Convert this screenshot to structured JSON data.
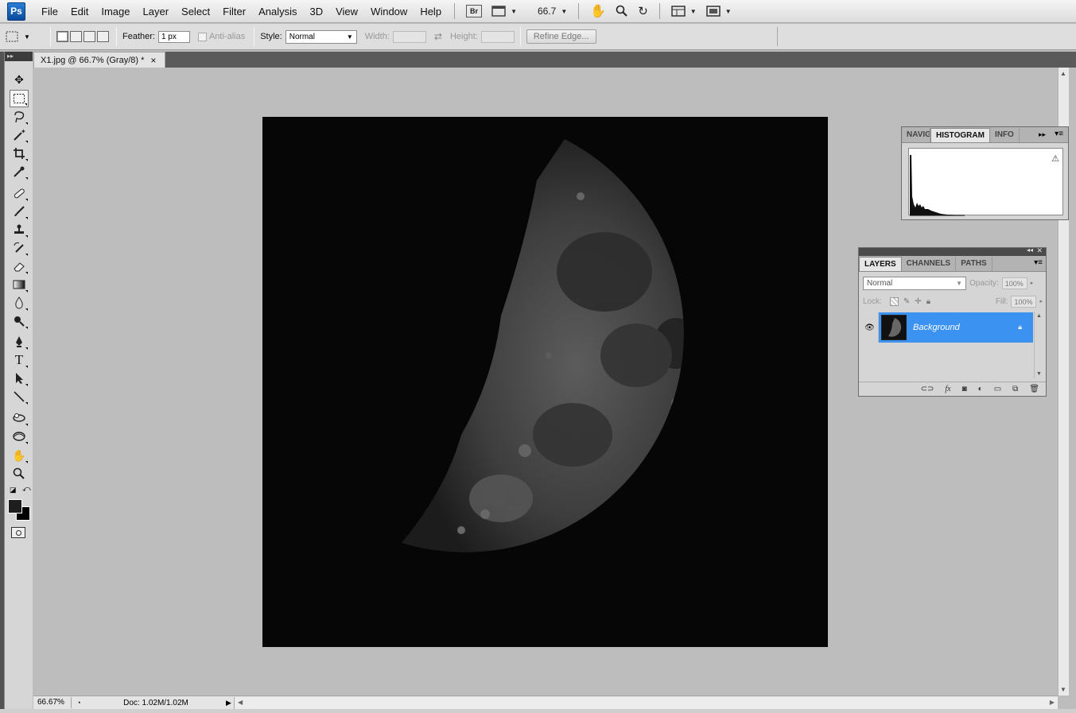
{
  "app": {
    "logo": "Ps"
  },
  "menu": [
    "File",
    "Edit",
    "Image",
    "Layer",
    "Select",
    "Filter",
    "Analysis",
    "3D",
    "View",
    "Window",
    "Help"
  ],
  "menubar_tools": {
    "bridge": "Br",
    "zoom_value": "66.7"
  },
  "options": {
    "feather_label": "Feather:",
    "feather_value": "1 px",
    "antialias_label": "Anti-alias",
    "style_label": "Style:",
    "style_value": "Normal",
    "width_label": "Width:",
    "height_label": "Height:",
    "refine_edge": "Refine Edge..."
  },
  "document": {
    "tab_title": "X1.jpg @ 66.7% (Gray/8) *",
    "close": "×"
  },
  "status": {
    "zoom": "66.67%",
    "doc_size": "Doc: 1.02M/1.02M"
  },
  "histogram_panel": {
    "tabs": [
      "NAVIG",
      "HISTOGRAM",
      "INFO"
    ],
    "active_tab": "HISTOGRAM"
  },
  "layers_panel": {
    "tabs": [
      "LAYERS",
      "CHANNELS",
      "PATHS"
    ],
    "active_tab": "LAYERS",
    "blend_mode": "Normal",
    "opacity_label": "Opacity:",
    "opacity_value": "100%",
    "lock_label": "Lock:",
    "fill_label": "Fill:",
    "fill_value": "100%",
    "layers": [
      {
        "name": "Background",
        "visible": true,
        "locked": true
      }
    ]
  },
  "icons": {
    "tools": [
      "move-tool-icon",
      "marquee-tool-icon",
      "lasso-tool-icon",
      "magic-wand-tool-icon",
      "crop-tool-icon",
      "eyedropper-tool-icon",
      "healing-brush-tool-icon",
      "brush-tool-icon",
      "clone-stamp-tool-icon",
      "history-brush-tool-icon",
      "eraser-tool-icon",
      "gradient-tool-icon",
      "blur-tool-icon",
      "dodge-tool-icon",
      "pen-tool-icon",
      "type-tool-icon",
      "path-selection-tool-icon",
      "line-tool-icon",
      "3d-rotate-tool-icon",
      "3d-orbit-tool-icon",
      "hand-tool-icon",
      "zoom-tool-icon"
    ]
  },
  "colors": {
    "foreground": "#1e1e1e",
    "background": "#000000",
    "layer_highlight": "#3b92f0"
  }
}
